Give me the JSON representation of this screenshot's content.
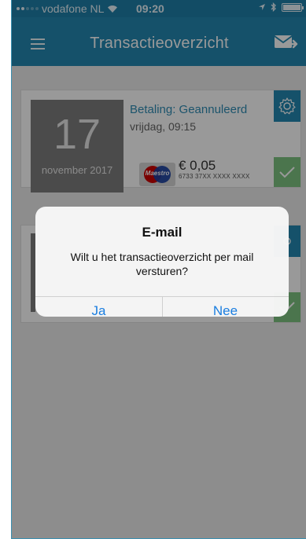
{
  "status_bar": {
    "carrier": "vodafone NL",
    "time": "09:20",
    "battery_level": 1.0
  },
  "nav": {
    "title": "Transactieoverzicht",
    "left_icon": "menu-icon",
    "right_icon": "mail-send-icon"
  },
  "transactions": [
    {
      "day": "17",
      "month_year": "november 2017",
      "status": "Betaling: Geannuleerd",
      "weekday_time": "vrijdag, 09:15",
      "card_brand": "Maestro",
      "amount": "€ 0,05",
      "card_number": "6733 37XX XXXX XXXX"
    }
  ],
  "alert": {
    "title": "E-mail",
    "message": "Wilt u het transactieoverzicht per mail versturen?",
    "buttons": {
      "yes": "Ja",
      "no": "Nee"
    }
  },
  "colors": {
    "accent": "#2387b1",
    "status_text": "#2f8db5",
    "confirm": "#7ec480",
    "alert_button": "#1a7ee0"
  }
}
